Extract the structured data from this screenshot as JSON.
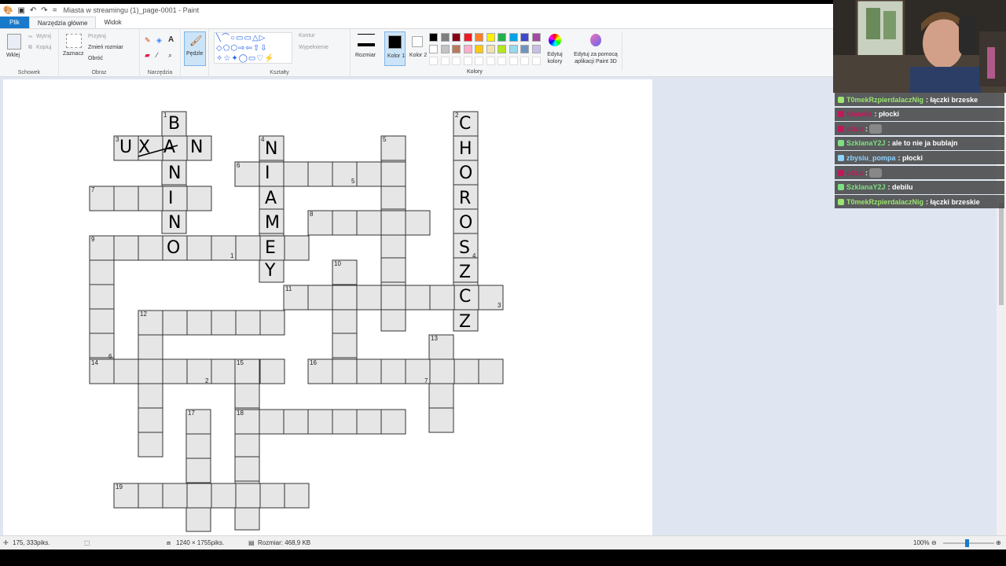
{
  "window": {
    "title": "Miasta w streamingu (1)_page-0001 - Paint"
  },
  "tabs": [
    {
      "label": "Plik"
    },
    {
      "label": "Narzędzia główne"
    },
    {
      "label": "Widok"
    }
  ],
  "ribbon": {
    "clipboard": {
      "paste": "Wklej",
      "cut": "Wytnij",
      "copy": "Kopiuj",
      "label": "Schowek"
    },
    "image": {
      "select": "Zaznacz",
      "crop": "Przytnij",
      "resize": "Zmień rozmiar",
      "rotate": "Obróć",
      "label": "Obraz"
    },
    "tools": {
      "label": "Narzędzia"
    },
    "brushes": {
      "label": "Pędzle"
    },
    "shapes": {
      "outline": "Kontur",
      "fill": "Wypełnienie",
      "label": "Kształty"
    },
    "size": {
      "label": "Rozmiar"
    },
    "color1": {
      "label": "Kolor 1"
    },
    "color2": {
      "label": "Kolor 2"
    },
    "edit_colors": {
      "label": "Edytuj kolory"
    },
    "paint3d": {
      "label": "Edytuj za pomocą aplikacji Paint 3D"
    },
    "colors": {
      "label": "Kolory"
    },
    "palette": [
      "#000000",
      "#7f7f7f",
      "#880015",
      "#ed1c24",
      "#ff7f27",
      "#fff200",
      "#22b14c",
      "#00a2e8",
      "#3f48cc",
      "#a349a4",
      "#ffffff",
      "#c3c3c3",
      "#b97a57",
      "#ffaec9",
      "#ffc90e",
      "#efe4b0",
      "#b5e61d",
      "#99d9ea",
      "#7092be",
      "#c8bfe7"
    ]
  },
  "statusbar": {
    "cursor": "175, 333piks.",
    "dimensions": "1240 × 1755piks.",
    "size": "Rozmiar: 468,9 KB",
    "zoom": "100%"
  },
  "crossword": {
    "numbers": [
      {
        "text": "1"
      },
      {
        "text": "2"
      },
      {
        "text": "3"
      },
      {
        "text": "4"
      },
      {
        "text": "5"
      },
      {
        "text": "6"
      },
      {
        "text": "7"
      },
      {
        "text": "8"
      },
      {
        "text": "9"
      },
      {
        "text": "10"
      },
      {
        "text": "11"
      },
      {
        "text": "12"
      },
      {
        "text": "13"
      },
      {
        "text": "14"
      },
      {
        "text": "15"
      },
      {
        "text": "16"
      },
      {
        "text": "17"
      },
      {
        "text": "18"
      },
      {
        "text": "19"
      },
      {
        "text": "5"
      },
      {
        "text": "1"
      },
      {
        "text": "4"
      },
      {
        "text": "3"
      },
      {
        "text": "6"
      },
      {
        "text": "2"
      },
      {
        "text": "7"
      }
    ],
    "letters": [
      "B",
      "N",
      "I",
      "N",
      "O",
      "C",
      "H",
      "O",
      "R",
      "O",
      "S",
      "Z",
      "C",
      "Z",
      "N",
      "I",
      "A",
      "M",
      "E",
      "Y",
      "U",
      "X",
      "A",
      "N"
    ]
  },
  "chat": [
    {
      "user": "T0mekRzpierdalaczNig",
      "message": ": łączki brzeske",
      "color": "#9ae66e"
    },
    {
      "user": "Klaudia",
      "message": ": płocki",
      "color": "#c2185b"
    },
    {
      "user": "pőzu",
      "message": ":",
      "color": "#c2185b"
    },
    {
      "user": "SzklanaY2J",
      "message": ": ale to nie ja bublajn",
      "color": "#7ee081"
    },
    {
      "user": "zbysiu_pompa",
      "message": ": płocki",
      "color": "#8fd3ff"
    },
    {
      "user": "pőzu",
      "message": ":",
      "color": "#c2185b"
    },
    {
      "user": "SzklanaY2J",
      "message": ": debilu",
      "color": "#7ee081"
    },
    {
      "user": "T0mekRzpierdalaczNig",
      "message": ": łączki brzeskie",
      "color": "#9ae66e"
    }
  ]
}
